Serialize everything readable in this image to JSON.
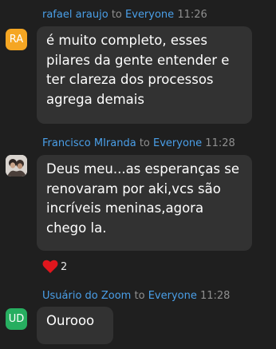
{
  "messages": [
    {
      "sender": "rafael araujo",
      "to_label": "to",
      "recipient": "Everyone",
      "time": "11:26",
      "avatar_initials": "RA",
      "avatar_color": "#f5a623",
      "text": "é muito completo, esses\npilares da gente entender e\nter clareza dos processos\nagrega demais"
    },
    {
      "sender": "Francisco MIranda",
      "to_label": "to",
      "recipient": "Everyone",
      "time": "11:28",
      "avatar_icon": "user-photo",
      "text": "Deus meu...as esperanças se\nrenovaram por aki,vcs são\nincríveis meninas,agora\nchego la."
    },
    {
      "sender": "Usuário do Zoom",
      "to_label": "to",
      "recipient": "Everyone",
      "time": "11:28",
      "avatar_initials": "UD",
      "avatar_color": "#27ae60",
      "text": "Ourooo"
    }
  ],
  "reaction": {
    "icon": "heart-icon",
    "color": "#e0161d",
    "count": "2"
  }
}
